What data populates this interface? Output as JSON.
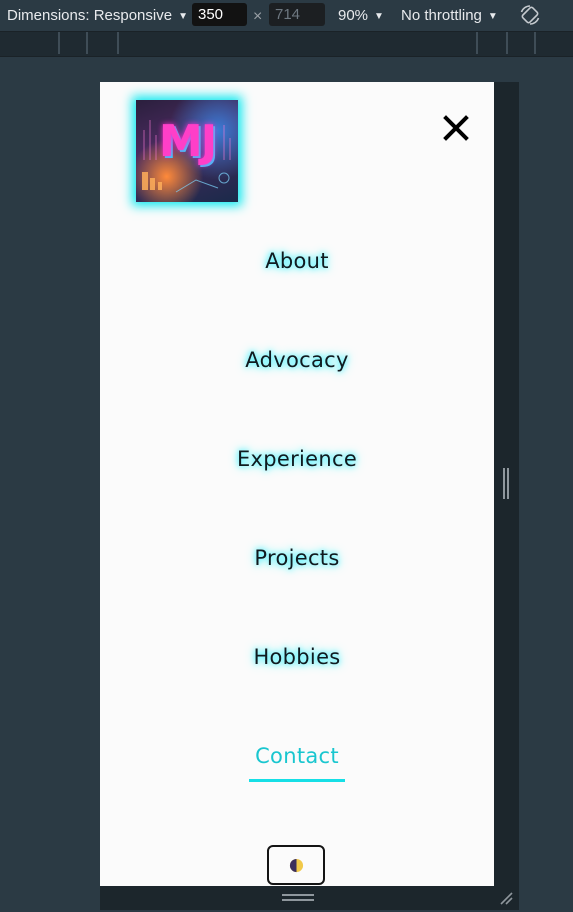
{
  "devtools": {
    "dimensions_label": "Dimensions: Responsive",
    "width_value": "350",
    "height_value": "714",
    "times_symbol": "×",
    "zoom_label": "90%",
    "throttling_label": "No throttling",
    "rotate_icon": "rotate-icon"
  },
  "page": {
    "logo_text": "MJ",
    "close_icon": "close-icon",
    "nav": [
      {
        "label": "About"
      },
      {
        "label": "Advocacy"
      },
      {
        "label": "Experience"
      },
      {
        "label": "Projects"
      },
      {
        "label": "Hobbies"
      },
      {
        "label": "Contact",
        "active": true
      }
    ],
    "theme_toggle_icon": "half-moon-contrast-icon",
    "colors": {
      "accent_glow": "#3ef3ff",
      "active_link": "#19c6cf",
      "underline": "#16dfe6",
      "theme_icon_dark": "#3b2f5c",
      "theme_icon_light": "#f1c94a"
    }
  }
}
